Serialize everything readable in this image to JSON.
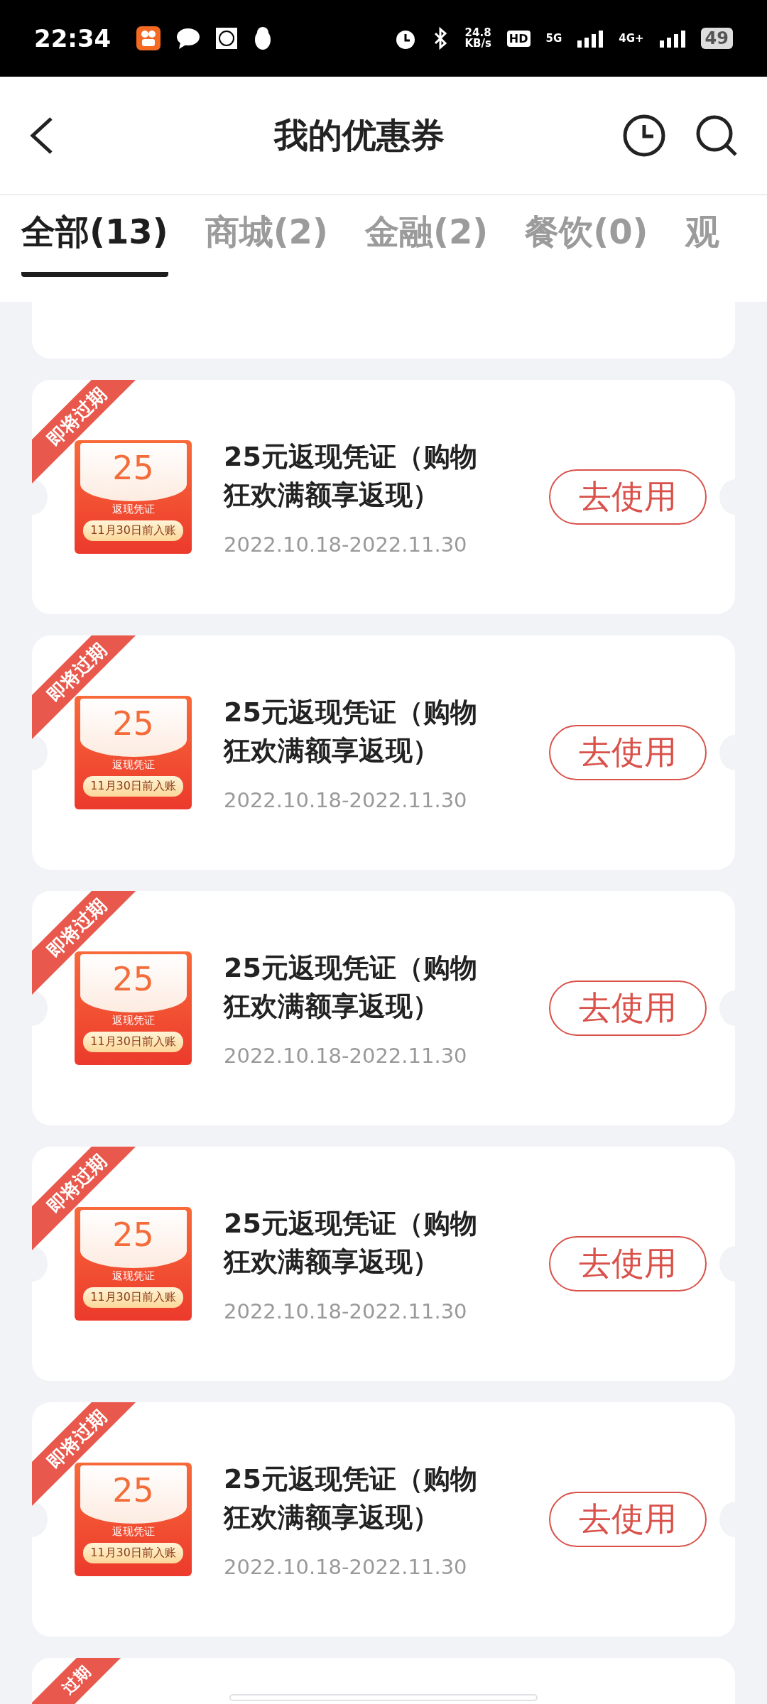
{
  "status_bar": {
    "time": "22:34",
    "net_speed": "24.8",
    "net_unit": "KB/s",
    "hd": "HD",
    "sim1": "5G",
    "sim2": "4G+",
    "battery": "49"
  },
  "header": {
    "title": "我的优惠券"
  },
  "tabs": [
    {
      "label": "全部(13)",
      "selected": true
    },
    {
      "label": "商城(2)",
      "selected": false
    },
    {
      "label": "金融(2)",
      "selected": false
    },
    {
      "label": "餐饮(0)",
      "selected": false
    },
    {
      "label": "观",
      "selected": false
    }
  ],
  "coupons": [
    {
      "badge": "即将过期",
      "amount": "25",
      "voucher_label": "返现凭证",
      "voucher_note": "11月30日前入账",
      "title": "25元返现凭证（购物狂欢满额享返现）",
      "dates": "2022.10.18-2022.11.30",
      "button": "去使用"
    },
    {
      "badge": "即将过期",
      "amount": "25",
      "voucher_label": "返现凭证",
      "voucher_note": "11月30日前入账",
      "title": "25元返现凭证（购物狂欢满额享返现）",
      "dates": "2022.10.18-2022.11.30",
      "button": "去使用"
    },
    {
      "badge": "即将过期",
      "amount": "25",
      "voucher_label": "返现凭证",
      "voucher_note": "11月30日前入账",
      "title": "25元返现凭证（购物狂欢满额享返现）",
      "dates": "2022.10.18-2022.11.30",
      "button": "去使用"
    },
    {
      "badge": "即将过期",
      "amount": "25",
      "voucher_label": "返现凭证",
      "voucher_note": "11月30日前入账",
      "title": "25元返现凭证（购物狂欢满额享返现）",
      "dates": "2022.10.18-2022.11.30",
      "button": "去使用"
    },
    {
      "badge": "即将过期",
      "amount": "25",
      "voucher_label": "返现凭证",
      "voucher_note": "11月30日前入账",
      "title": "25元返现凭证（购物狂欢满额享返现）",
      "dates": "2022.10.18-2022.11.30",
      "button": "去使用"
    }
  ],
  "last_card": {
    "badge": "过期"
  }
}
